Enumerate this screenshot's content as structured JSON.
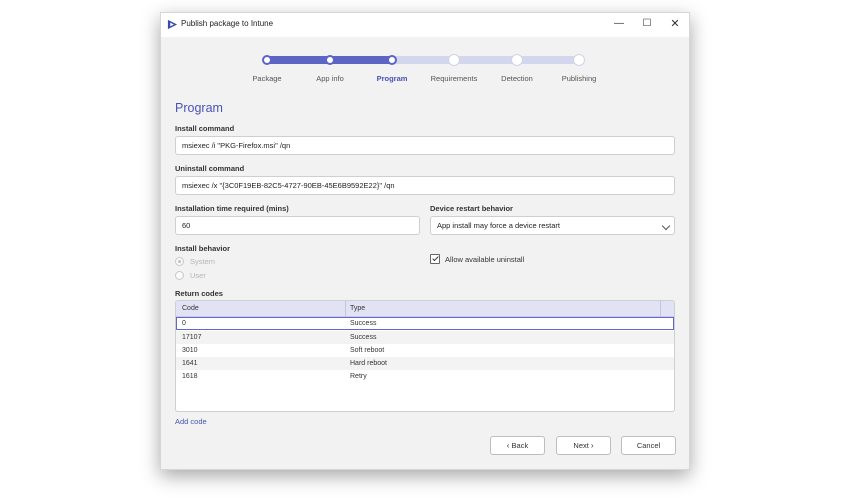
{
  "window": {
    "title": "Publish package to Intune",
    "controls": {
      "minimize": "—",
      "maximize": "☐",
      "close": "✕"
    }
  },
  "stepper": {
    "steps": [
      "Package",
      "App info",
      "Program",
      "Requirements",
      "Detection",
      "Publishing"
    ],
    "active_index": 2,
    "progress_fraction": 0.4,
    "accent_color": "#5c64c4"
  },
  "program": {
    "section_title": "Program",
    "install_command": {
      "label": "Install command",
      "value": "msiexec /i \"PKG-Firefox.msi\" /qn"
    },
    "uninstall_command": {
      "label": "Uninstall command",
      "value": "msiexec /x \"{3C0F19EB-82C5-4727-90EB-45E6B9592E22}\" /qn"
    },
    "install_time": {
      "label": "Installation time required (mins)",
      "value": "60"
    },
    "restart_behavior": {
      "label": "Device restart behavior",
      "value": "App install may force a device restart"
    },
    "install_behavior": {
      "label": "Install behavior",
      "options": [
        "System",
        "User"
      ],
      "selected": "System"
    },
    "allow_uninstall": {
      "label": "Allow available uninstall",
      "checked": true
    }
  },
  "return_codes": {
    "label": "Return codes",
    "columns": [
      "Code",
      "Type"
    ],
    "rows": [
      {
        "code": "0",
        "type": "Success"
      },
      {
        "code": "17107",
        "type": "Success"
      },
      {
        "code": "3010",
        "type": "Soft reboot"
      },
      {
        "code": "1641",
        "type": "Hard reboot"
      },
      {
        "code": "1618",
        "type": "Retry"
      }
    ],
    "add_label": "Add code"
  },
  "footer": {
    "back_label": "Back",
    "back_icon": "‹",
    "next_label": "Next",
    "next_icon": "›",
    "cancel_label": "Cancel"
  }
}
